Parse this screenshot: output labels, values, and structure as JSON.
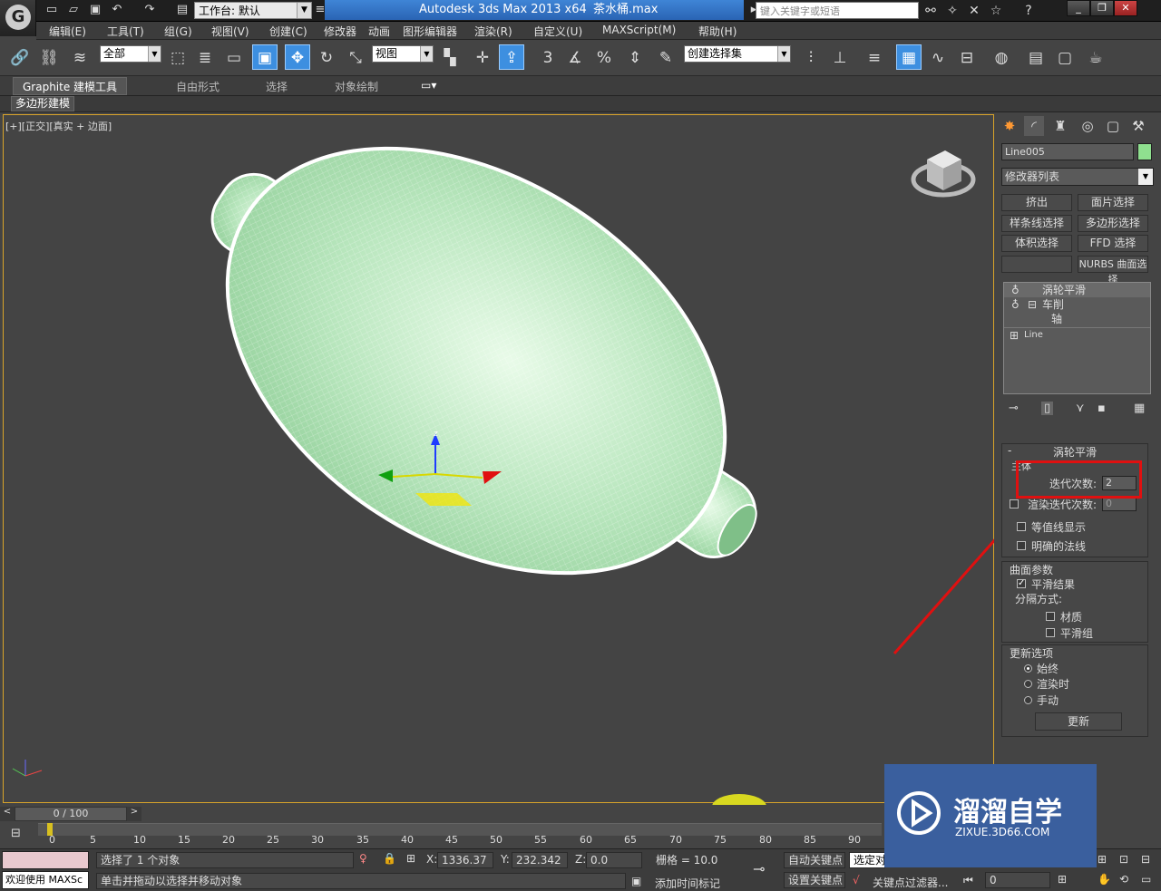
{
  "app": {
    "workspace_prefix": "工作台: 默认",
    "title_app": "Autodesk 3ds Max  2013 x64",
    "title_file": "茶水桶.max",
    "search_placeholder": "键入关键字或短语"
  },
  "menu": [
    "编辑(E)",
    "工具(T)",
    "组(G)",
    "视图(V)",
    "创建(C)",
    "修改器",
    "动画",
    "图形编辑器",
    "渲染(R)",
    "自定义(U)",
    "MAXScript(M)",
    "帮助(H)"
  ],
  "toolbar": {
    "filter_select": "全部",
    "ref_coord": "视图",
    "named_sel_set": "创建选择集",
    "snap_3": "3",
    "percent": "%"
  },
  "ribbon": {
    "tabs": [
      "Graphite 建模工具",
      "自由形式",
      "选择",
      "对象绘制"
    ],
    "active_subtab": "多边形建模"
  },
  "viewport": {
    "label": "[+][正交][真实 + 边面]",
    "axis_z": "z"
  },
  "cmdpanel": {
    "object_name": "Line005",
    "object_color": "#8fe08f",
    "modifier_list": "修改器列表",
    "mod_buttons": [
      "挤出",
      "面片选择",
      "样条线选择",
      "多边形选择",
      "体积选择",
      "FFD 选择",
      "",
      "NURBS 曲面选择"
    ],
    "stack": [
      "涡轮平滑",
      "车削",
      "轴",
      "Line"
    ],
    "turbosmooth": {
      "title": "涡轮平滑",
      "main_label": "主体",
      "iterations_label": "迭代次数:",
      "iterations": "2",
      "render_iters_label": "渲染迭代次数:",
      "render_iters": "0",
      "isoline": "等值线显示",
      "explicit_normals": "明确的法线",
      "surface_title": "曲面参数",
      "smooth_result": "平滑结果",
      "separate_by": "分隔方式:",
      "materials": "材质",
      "smoothing_groups": "平滑组",
      "update_title": "更新选项",
      "always": "始终",
      "when_rendering": "渲染时",
      "manually": "手动",
      "update_button": "更新"
    }
  },
  "timeline": {
    "frame": "0 / 100",
    "ticks": [
      "0",
      "5",
      "10",
      "15",
      "20",
      "25",
      "30",
      "35",
      "40",
      "45",
      "50",
      "55",
      "60",
      "65",
      "70",
      "75",
      "80",
      "85",
      "90"
    ]
  },
  "status": {
    "selected": "选择了 1 个对象",
    "prompt": "单击并拖动以选择并移动对象",
    "welcome": "欢迎使用 MAXSc",
    "x_label": "X:",
    "x": "1336.37",
    "y_label": "Y:",
    "y": "232.342",
    "z_label": "Z:",
    "z": "0.0",
    "grid": "栅格 = 10.0",
    "add_time_tag": "添加时间标记",
    "auto_key": "自动关键点",
    "set_key": "设置关键点",
    "selected_obj": "选定对",
    "key_filters": "关键点过滤器...",
    "frame_field": "0"
  },
  "watermark": {
    "brand": "溜溜自学",
    "url": "ZIXUE.3D66.COM"
  },
  "colors": {
    "accent": "#3d8fe0",
    "highlight_box": "#e01010",
    "wire": "#ffffff",
    "mesh_fill": "#a8ddb0"
  }
}
